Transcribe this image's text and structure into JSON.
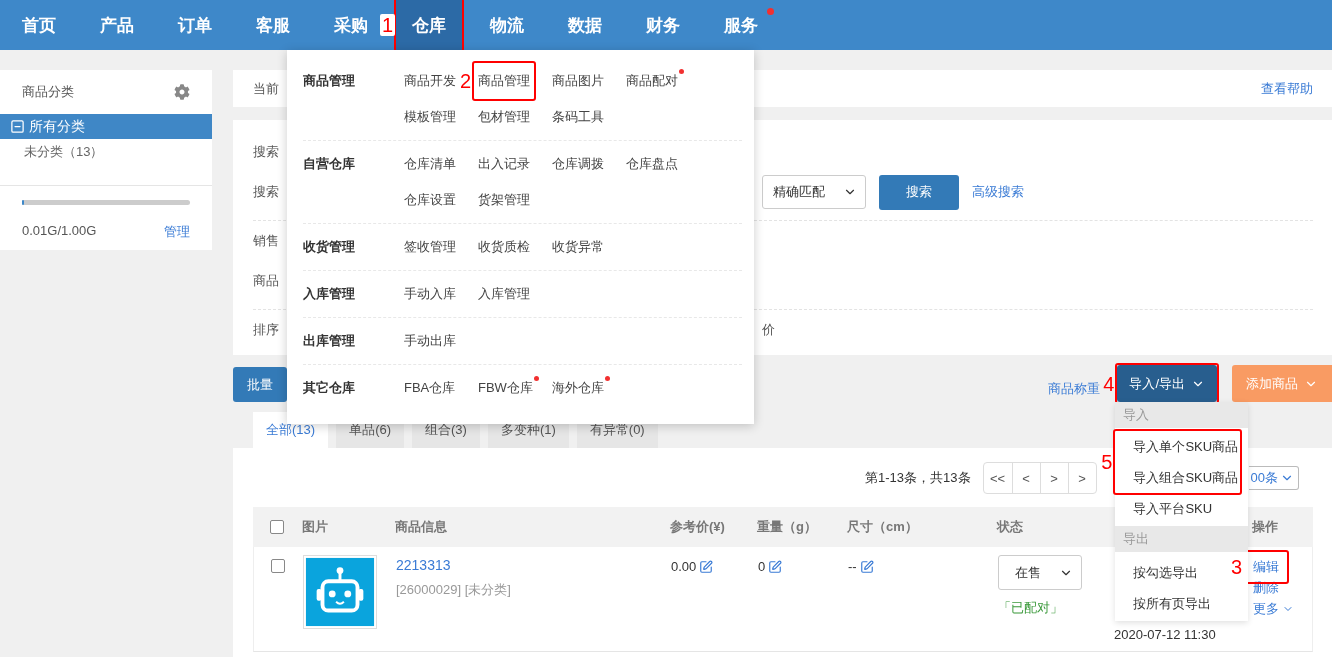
{
  "nav": {
    "items": [
      {
        "label": "首页",
        "selected": false,
        "dot": false
      },
      {
        "label": "产品",
        "selected": false,
        "dot": false
      },
      {
        "label": "订单",
        "selected": false,
        "dot": false
      },
      {
        "label": "客服",
        "selected": false,
        "dot": false
      },
      {
        "label": "采购",
        "selected": false,
        "dot": false
      },
      {
        "label": "仓库",
        "selected": true,
        "dot": false,
        "callout": "1"
      },
      {
        "label": "物流",
        "selected": false,
        "dot": false
      },
      {
        "label": "数据",
        "selected": false,
        "dot": false
      },
      {
        "label": "财务",
        "selected": false,
        "dot": false
      },
      {
        "label": "服务",
        "selected": false,
        "dot": true
      }
    ]
  },
  "mega_menu": {
    "groups": [
      {
        "title": "商品管理",
        "items": [
          {
            "label": "商品开发",
            "dot": false
          },
          {
            "label": "商品管理",
            "dot": false,
            "callout": "2"
          },
          {
            "label": "商品图片",
            "dot": false
          },
          {
            "label": "商品配对",
            "dot": true
          },
          {
            "label": "模板管理",
            "dot": false
          },
          {
            "label": "包材管理",
            "dot": false
          },
          {
            "label": "条码工具",
            "dot": false
          }
        ]
      },
      {
        "title": "自营仓库",
        "items": [
          {
            "label": "仓库清单",
            "dot": false
          },
          {
            "label": "出入记录",
            "dot": false
          },
          {
            "label": "仓库调拨",
            "dot": false
          },
          {
            "label": "仓库盘点",
            "dot": false
          },
          {
            "label": "仓库设置",
            "dot": false
          },
          {
            "label": "货架管理",
            "dot": false
          }
        ]
      },
      {
        "title": "收货管理",
        "items": [
          {
            "label": "签收管理",
            "dot": false
          },
          {
            "label": "收货质检",
            "dot": false
          },
          {
            "label": "收货异常",
            "dot": false
          }
        ]
      },
      {
        "title": "入库管理",
        "items": [
          {
            "label": "手动入库",
            "dot": false
          },
          {
            "label": "入库管理",
            "dot": false
          }
        ]
      },
      {
        "title": "出库管理",
        "items": [
          {
            "label": "手动出库",
            "dot": false
          }
        ]
      },
      {
        "title": "其它仓库",
        "items": [
          {
            "label": "FBA仓库",
            "dot": false
          },
          {
            "label": "FBW仓库",
            "dot": true
          },
          {
            "label": "海外仓库",
            "dot": true
          }
        ]
      }
    ]
  },
  "sidebar": {
    "title": "商品分类",
    "tree": [
      {
        "label": "所有分类",
        "selected": true,
        "expanded": true,
        "children": [
          {
            "label": "未分类（13）",
            "selected": false
          }
        ]
      }
    ],
    "storage": {
      "level": 0.01,
      "text": "0.01G/1.00G",
      "link": "管理"
    }
  },
  "breadcrumb": {
    "text": "当前",
    "help": "查看帮助"
  },
  "search": {
    "sections": [
      {
        "rows": [
          {
            "label": "搜索"
          },
          {
            "label": "搜索",
            "match_select": "精确匹配",
            "button": "搜索",
            "advanced": "高级搜索"
          }
        ]
      },
      {
        "rows": [
          {
            "label": "销售"
          },
          {
            "label": "商品"
          }
        ]
      },
      {
        "rows": [
          {
            "label": "排序",
            "tail": "价"
          }
        ]
      }
    ]
  },
  "toolbar": {
    "batch": "批量",
    "weigh": "商品称重",
    "add": "添加商品",
    "import_export": {
      "label": "导入/导出",
      "callout": "4",
      "open": true,
      "sections": [
        {
          "header": "导入",
          "items": [
            {
              "kind": "group",
              "callout": "5",
              "items": [
                {
                  "label": "导入单个SKU商品"
                },
                {
                  "label": "导入组合SKU商品"
                }
              ]
            },
            {
              "kind": "item",
              "label": "导入平台SKU"
            }
          ]
        },
        {
          "header": "导出",
          "items": [
            {
              "kind": "item",
              "label": "按勾选导出"
            },
            {
              "kind": "item",
              "label": "按所有页导出"
            }
          ]
        }
      ]
    }
  },
  "tabs": [
    {
      "label": "全部(13)",
      "selected": true
    },
    {
      "label": "单品(6)",
      "selected": false
    },
    {
      "label": "组合(3)",
      "selected": false
    },
    {
      "label": "多变种(1)",
      "selected": false
    },
    {
      "label": "有异常(0)",
      "selected": false
    }
  ],
  "pagination": {
    "summary": "第1-13条，共13条",
    "buttons": [
      "<<",
      "<",
      ">",
      ">"
    ],
    "page_size": "00条"
  },
  "table": {
    "select_all_checked": false,
    "columns": [
      "图片",
      "商品信息",
      "参考价(¥)",
      "重量（g）",
      "尺寸（cm）",
      "状态",
      "操作"
    ],
    "rows": [
      {
        "checked": false,
        "name": "2213313",
        "meta": "[26000029] [未分类]",
        "price": "0.00",
        "weight": "0",
        "size": "--",
        "status": "在售",
        "match": "「已配对」",
        "time": "2020-07-12 11:30",
        "actions": [
          {
            "label": "编辑",
            "callout": "3"
          },
          {
            "label": "删除"
          },
          {
            "label": "更多",
            "caret": true
          }
        ]
      }
    ]
  }
}
